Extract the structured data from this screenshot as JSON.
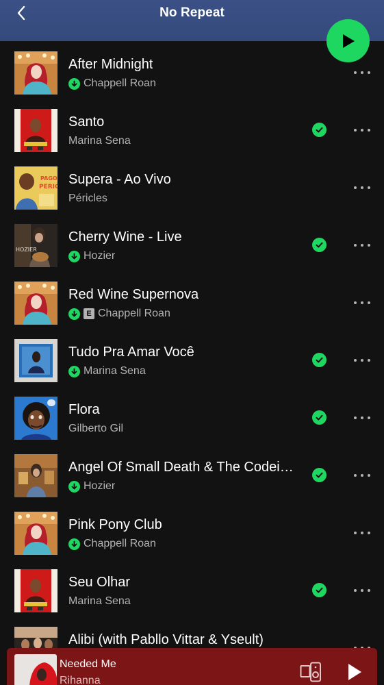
{
  "header": {
    "title": "No Repeat"
  },
  "colors": {
    "accent": "#1ed760",
    "header_bg": "#3b5186",
    "background": "#121212",
    "now_playing_bg": "#7c1616"
  },
  "tracks": [
    {
      "title": "After Midnight",
      "artist": "Chappell Roan",
      "downloaded": true,
      "explicit": false,
      "added": false,
      "art": "chappell"
    },
    {
      "title": "Santo",
      "artist": "Marina Sena",
      "downloaded": false,
      "explicit": false,
      "added": true,
      "art": "marina-red"
    },
    {
      "title": "Supera - Ao Vivo",
      "artist": "Péricles",
      "downloaded": false,
      "explicit": false,
      "added": false,
      "art": "pericles"
    },
    {
      "title": "Cherry Wine - Live",
      "artist": "Hozier",
      "downloaded": true,
      "explicit": false,
      "added": true,
      "art": "hozier-live"
    },
    {
      "title": "Red Wine Supernova",
      "artist": "Chappell Roan",
      "downloaded": true,
      "explicit": true,
      "added": false,
      "art": "chappell"
    },
    {
      "title": "Tudo Pra Amar Você",
      "artist": "Marina Sena",
      "downloaded": true,
      "explicit": false,
      "added": true,
      "art": "marina-blue"
    },
    {
      "title": "Flora",
      "artist": "Gilberto Gil",
      "downloaded": false,
      "explicit": false,
      "added": true,
      "art": "gil"
    },
    {
      "title": "Angel Of Small Death & The Codeine Scene",
      "artist": "Hozier",
      "downloaded": true,
      "explicit": false,
      "added": true,
      "art": "hozier"
    },
    {
      "title": "Pink Pony Club",
      "artist": "Chappell Roan",
      "downloaded": true,
      "explicit": false,
      "added": false,
      "art": "chappell"
    },
    {
      "title": "Seu Olhar",
      "artist": "Marina Sena",
      "downloaded": false,
      "explicit": false,
      "added": true,
      "art": "marina-red"
    },
    {
      "title": "Alibi (with Pabllo Vittar & Yseult)",
      "artist": "",
      "downloaded": false,
      "explicit": false,
      "added": false,
      "art": "alibi"
    }
  ],
  "explicit_label": "E",
  "now_playing": {
    "title": "Needed Me",
    "artist": "Rihanna"
  }
}
